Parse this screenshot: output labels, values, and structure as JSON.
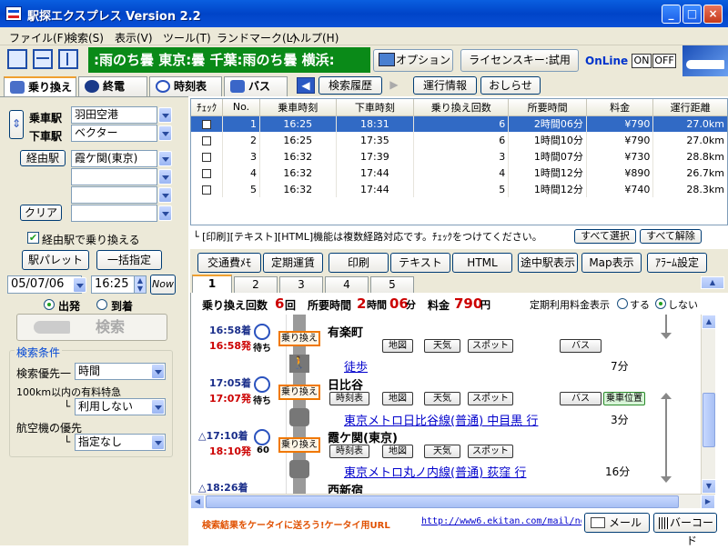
{
  "window": {
    "title": "駅探エクスプレス Version 2.2",
    "buttons": [
      "_",
      "□",
      "×"
    ]
  },
  "menu": [
    "ファイル(F)",
    "検索(S)",
    "表示(V)",
    "ツール(T)",
    "ランドマーク(L)",
    "ヘルプ(H)"
  ],
  "toolbar": {
    "ticker": ":雨のち曇 東京:曇 千葉:雨のち曇 横浜:",
    "option": "オプション",
    "license": "ライセンスキー:試用",
    "online": "OnLine",
    "on": "ON",
    "off": "OFF"
  },
  "tabs": [
    {
      "label": "乗り換え"
    },
    {
      "label": "終電"
    },
    {
      "label": "時刻表"
    },
    {
      "label": "バス"
    }
  ],
  "nav": {
    "history": "検索履歴",
    "info": "運行情報",
    "notice": "おしらせ"
  },
  "left": {
    "board_label": "乗車駅",
    "board_value": "羽田空港",
    "alight_label": "下車駅",
    "alight_value": "ベクター",
    "via_button": "経由駅",
    "via_value": "霞ケ関(東京)",
    "clear_button": "クリア",
    "via_transfer": "経由駅で乗り換える",
    "palette_button": "駅パレット",
    "bulk_button": "一括指定",
    "date": "05/07/06",
    "time": "16:25",
    "now_button": "Now",
    "depart": "出発",
    "arrive": "到着",
    "search_button": "検索",
    "cond_title": "検索条件",
    "priority_label": "検索優先一",
    "priority_value": "時間",
    "express_label": "100km以内の有料特急",
    "express_value": "利用しない",
    "air_label": "航空機の優先",
    "air_value": "指定なし"
  },
  "results": {
    "headers": [
      "ﾁｪｯｸ",
      "No.",
      "乗車時刻",
      "下車時刻",
      "乗り換え回数",
      "所要時間",
      "料金",
      "運行距離"
    ],
    "rows": [
      [
        "",
        "1",
        "16:25",
        "18:31",
        "6",
        "2時間06分",
        "¥790",
        "27.0km"
      ],
      [
        "",
        "2",
        "16:25",
        "17:35",
        "6",
        "1時間10分",
        "¥790",
        "27.0km"
      ],
      [
        "",
        "3",
        "16:32",
        "17:39",
        "3",
        "1時間07分",
        "¥730",
        "28.8km"
      ],
      [
        "",
        "4",
        "16:32",
        "17:44",
        "4",
        "1時間12分",
        "¥890",
        "26.7km"
      ],
      [
        "",
        "5",
        "16:32",
        "17:44",
        "5",
        "1時間12分",
        "¥740",
        "28.3km"
      ]
    ],
    "note": "└ [印刷][テキスト][HTML]機能は複数経路対応です。ﾁｪｯｸをつけてください。",
    "select_all": "すべて選択",
    "deselect_all": "すべて解除"
  },
  "actions": [
    "交通費ﾒﾓ",
    "定期運賃",
    "印刷",
    "テキスト",
    "HTML",
    "途中駅表示",
    "Map表示",
    "ｱﾗｰﾑ設定"
  ],
  "route_tabs": [
    "1",
    "2",
    "3",
    "4",
    "5"
  ],
  "summary": {
    "transfers_label": "乗り換え回数",
    "transfers": "6",
    "transfers_unit": "回",
    "duration_label": "所要時間",
    "hours": "2",
    "hours_unit": "時間",
    "minutes": "06",
    "minutes_unit": "分",
    "fare_label": "料金",
    "fare": "790",
    "fare_unit": "円",
    "pass_label": "定期利用料金表示",
    "pass_on": "する",
    "pass_off": "しない"
  },
  "route": {
    "s1_arr": "16:58着",
    "s1_dep": "16:58発",
    "s1_wait": "待ち",
    "s1_name": "有楽町",
    "s1_transfer": "乗り換え",
    "walk": "徒歩",
    "walk_time": "7分",
    "s2_arr": "17:05着",
    "s2_dep": "17:07発",
    "s2_wait": "待ち",
    "s2_name": "日比谷",
    "s2_transfer": "乗り換え",
    "line1": "東京メトロ日比谷線(普通) 中目黒 行",
    "line1_time": "3分",
    "s3_arr": "△17:10着",
    "s3_dep": "18:10発",
    "s3_wait": "60",
    "s3_name": "霞ケ関(東京)",
    "s3_transfer": "乗り換え",
    "line2": "東京メトロ丸ノ内線(普通) 荻窪 行",
    "line2_time": "16分",
    "s4_arr": "△18:26着",
    "s4_name": "西新宿",
    "btn_timetable": "時刻表",
    "btn_map": "地図",
    "btn_weather": "天気",
    "btn_spot": "スポット",
    "btn_bus": "バス",
    "btn_pos": "乗車位置"
  },
  "footer": {
    "promo": "検索結果をケータイに送ろう!ケータイ用URL",
    "url": "http://www6.ekitan.com/mail/no",
    "mail": "メール",
    "barcode": "バーコード"
  }
}
